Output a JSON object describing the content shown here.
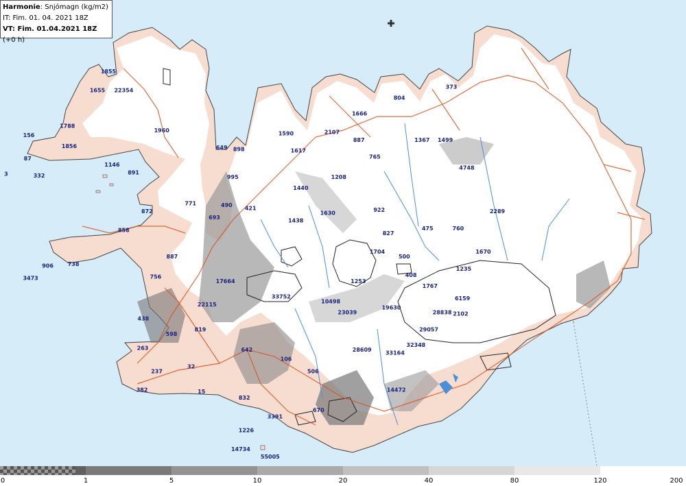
{
  "header": {
    "model": "Harmonie",
    "parameter": ": Snjómagn (kg/m2)",
    "issue_time": "IT: Fim. 01. 04. 2021 18Z",
    "valid_time_bold": "VT: Fim. 01.04.2021 18Z",
    "valid_offset": " (+0 h)"
  },
  "colors": {
    "sea": "#d6ecf8",
    "land": "#f7ddd0",
    "snow": "#ffffff",
    "roads": "#d9531e",
    "rivers": "#4a90d9",
    "labels": "#1a237e"
  },
  "legend": {
    "ticks": [
      "0",
      "1",
      "5",
      "10",
      "20",
      "40",
      "80",
      "120",
      "200"
    ],
    "colors": [
      "#606060",
      "#7a7a7a",
      "#939393",
      "#aaaaaa",
      "#c0c0c0",
      "#d6d6d6",
      "#e8e8e8",
      "#ffffff"
    ]
  },
  "stations": [
    {
      "value": "1855",
      "lon": -22.73,
      "lat": 66.21
    },
    {
      "value": "1655",
      "lon": -22.91,
      "lat": 66.09
    },
    {
      "value": "22354",
      "lon": -22.48,
      "lat": 66.09
    },
    {
      "value": "1788",
      "lon": -23.4,
      "lat": 65.86
    },
    {
      "value": "156",
      "lon": -24.03,
      "lat": 65.8
    },
    {
      "value": "1960",
      "lon": -21.86,
      "lat": 65.83
    },
    {
      "value": "1856",
      "lon": -23.37,
      "lat": 65.73
    },
    {
      "value": "87",
      "lon": -24.05,
      "lat": 65.65
    },
    {
      "value": "3",
      "lon": -24.4,
      "lat": 65.55
    },
    {
      "value": "332",
      "lon": -23.86,
      "lat": 65.54
    },
    {
      "value": "1146",
      "lon": -22.67,
      "lat": 65.61
    },
    {
      "value": "891",
      "lon": -22.32,
      "lat": 65.56
    },
    {
      "value": "872",
      "lon": -22.1,
      "lat": 65.31
    },
    {
      "value": "858",
      "lon": -22.48,
      "lat": 65.19
    },
    {
      "value": "906",
      "lon": -23.72,
      "lat": 64.96
    },
    {
      "value": "738",
      "lon": -23.3,
      "lat": 64.97
    },
    {
      "value": "3473",
      "lon": -24.0,
      "lat": 64.88
    },
    {
      "value": "756",
      "lon": -21.96,
      "lat": 64.89
    },
    {
      "value": "887",
      "lon": -21.69,
      "lat": 65.02
    },
    {
      "value": "438",
      "lon": -22.16,
      "lat": 64.62
    },
    {
      "value": "598",
      "lon": -21.7,
      "lat": 64.52
    },
    {
      "value": "263",
      "lon": -22.17,
      "lat": 64.43
    },
    {
      "value": "237",
      "lon": -21.94,
      "lat": 64.28
    },
    {
      "value": "382",
      "lon": -22.18,
      "lat": 64.16
    },
    {
      "value": "32",
      "lon": -21.38,
      "lat": 64.31
    },
    {
      "value": "15",
      "lon": -21.21,
      "lat": 64.15
    },
    {
      "value": "819",
      "lon": -21.23,
      "lat": 64.55
    },
    {
      "value": "22115",
      "lon": -21.12,
      "lat": 64.71
    },
    {
      "value": "17664",
      "lon": -20.82,
      "lat": 64.86
    },
    {
      "value": "771",
      "lon": -21.39,
      "lat": 65.36
    },
    {
      "value": "693",
      "lon": -21.0,
      "lat": 65.27
    },
    {
      "value": "490",
      "lon": -20.8,
      "lat": 65.35
    },
    {
      "value": "649",
      "lon": -20.88,
      "lat": 65.72
    },
    {
      "value": "898",
      "lon": -20.6,
      "lat": 65.71
    },
    {
      "value": "995",
      "lon": -20.7,
      "lat": 65.53
    },
    {
      "value": "421",
      "lon": -20.41,
      "lat": 65.33
    },
    {
      "value": "1590",
      "lon": -19.83,
      "lat": 65.81
    },
    {
      "value": "1617",
      "lon": -19.63,
      "lat": 65.7
    },
    {
      "value": "2107",
      "lon": -19.08,
      "lat": 65.82
    },
    {
      "value": "1666",
      "lon": -18.63,
      "lat": 65.94
    },
    {
      "value": "804",
      "lon": -17.98,
      "lat": 66.04
    },
    {
      "value": "373",
      "lon": -17.13,
      "lat": 66.11
    },
    {
      "value": "887",
      "lon": -18.64,
      "lat": 65.77
    },
    {
      "value": "765",
      "lon": -18.38,
      "lat": 65.66
    },
    {
      "value": "1367",
      "lon": -17.61,
      "lat": 65.77
    },
    {
      "value": "1499",
      "lon": -17.23,
      "lat": 65.77
    },
    {
      "value": "4748",
      "lon": -16.88,
      "lat": 65.59
    },
    {
      "value": "1208",
      "lon": -18.97,
      "lat": 65.53
    },
    {
      "value": "1440",
      "lon": -19.59,
      "lat": 65.46
    },
    {
      "value": "1630",
      "lon": -19.15,
      "lat": 65.3
    },
    {
      "value": "1438",
      "lon": -19.67,
      "lat": 65.25
    },
    {
      "value": "922",
      "lon": -18.31,
      "lat": 65.32
    },
    {
      "value": "2289",
      "lon": -16.38,
      "lat": 65.31
    },
    {
      "value": "475",
      "lon": -17.52,
      "lat": 65.2
    },
    {
      "value": "760",
      "lon": -17.02,
      "lat": 65.2
    },
    {
      "value": "827",
      "lon": -18.16,
      "lat": 65.17
    },
    {
      "value": "1670",
      "lon": -16.61,
      "lat": 65.05
    },
    {
      "value": "1704",
      "lon": -18.34,
      "lat": 65.05
    },
    {
      "value": "500",
      "lon": -17.9,
      "lat": 65.02
    },
    {
      "value": "1235",
      "lon": -16.93,
      "lat": 64.94
    },
    {
      "value": "408",
      "lon": -17.79,
      "lat": 64.9
    },
    {
      "value": "1253",
      "lon": -18.65,
      "lat": 64.86
    },
    {
      "value": "1767",
      "lon": -17.48,
      "lat": 64.83
    },
    {
      "value": "6159",
      "lon": -16.95,
      "lat": 64.75
    },
    {
      "value": "33752",
      "lon": -19.91,
      "lat": 64.76
    },
    {
      "value": "10498",
      "lon": -19.1,
      "lat": 64.73
    },
    {
      "value": "23039",
      "lon": -18.83,
      "lat": 64.66
    },
    {
      "value": "19630",
      "lon": -18.11,
      "lat": 64.69
    },
    {
      "value": "28838",
      "lon": -17.28,
      "lat": 64.66
    },
    {
      "value": "2102",
      "lon": -16.98,
      "lat": 64.65
    },
    {
      "value": "29057",
      "lon": -17.5,
      "lat": 64.55
    },
    {
      "value": "32348",
      "lon": -17.71,
      "lat": 64.45
    },
    {
      "value": "28609",
      "lon": -18.59,
      "lat": 64.42
    },
    {
      "value": "33164",
      "lon": -18.05,
      "lat": 64.4
    },
    {
      "value": "642",
      "lon": -20.47,
      "lat": 64.42
    },
    {
      "value": "106",
      "lon": -19.83,
      "lat": 64.36
    },
    {
      "value": "506",
      "lon": -19.39,
      "lat": 64.28
    },
    {
      "value": "14472",
      "lon": -18.03,
      "lat": 64.16
    },
    {
      "value": "832",
      "lon": -20.51,
      "lat": 64.11
    },
    {
      "value": "670",
      "lon": -19.3,
      "lat": 64.03
    },
    {
      "value": "3391",
      "lon": -20.01,
      "lat": 63.99
    },
    {
      "value": "1226",
      "lon": -20.48,
      "lat": 63.9
    },
    {
      "value": "14734",
      "lon": -20.57,
      "lat": 63.78
    },
    {
      "value": "55005",
      "lon": -20.09,
      "lat": 63.73
    }
  ]
}
